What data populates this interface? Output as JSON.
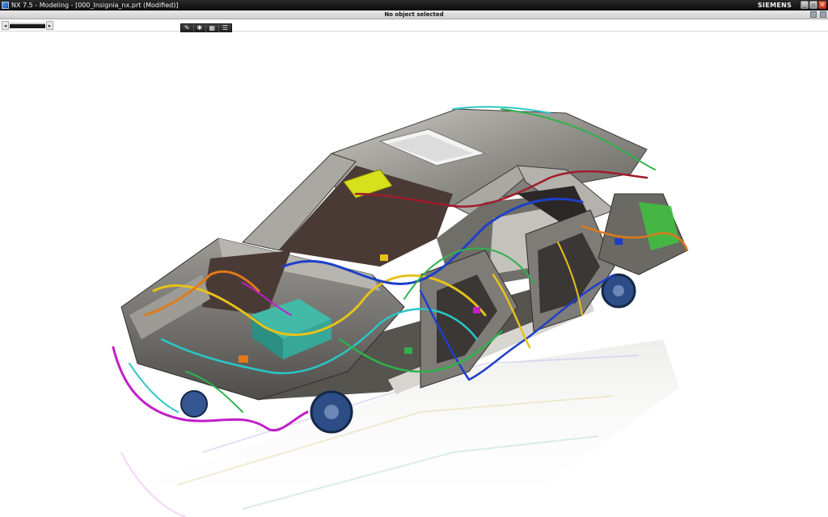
{
  "window": {
    "title": "NX 7.5 - Modeling - [000_Insignia_nx.prt (Modified)]",
    "brand": "SIEMENS",
    "min_glyph": "_",
    "max_glyph": "▫",
    "close_glyph": "×"
  },
  "status": {
    "message": "No object selected"
  },
  "nav": {
    "left_glyph": "◂",
    "right_glyph": "▸"
  },
  "toolbar": {
    "buttons": [
      {
        "icon": "render-style-icon",
        "glyph": "✎"
      },
      {
        "icon": "settings-icon",
        "glyph": "✱"
      },
      {
        "icon": "grid-icon",
        "glyph": "▦"
      },
      {
        "icon": "layout-icon",
        "glyph": "☰"
      }
    ]
  },
  "colors": {
    "titlebar": "#111111",
    "statusbar": "#d8d8d8",
    "viewport": "#ffffff",
    "body_panel": "#8d8c86",
    "dark_interior": "#4a3a36",
    "wire_yellow": "#e6c21a",
    "wire_blue": "#1f3fc9",
    "wire_magenta": "#c21ec9",
    "wire_green": "#2fb24a",
    "wire_orange": "#e07a18",
    "wire_cyan": "#2ac6c6",
    "suspension": "#2e4d86"
  },
  "viewport": {
    "model": "car-body-wiring-harness"
  }
}
